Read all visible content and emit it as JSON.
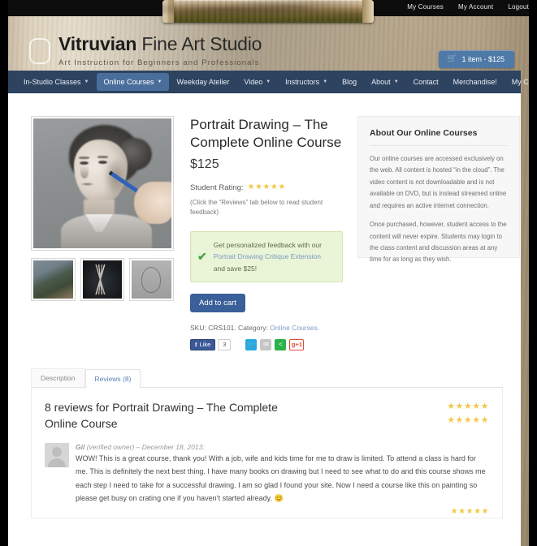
{
  "topnav": {
    "items": [
      {
        "label": "My Courses"
      },
      {
        "label": "My Account"
      },
      {
        "label": "Logout"
      }
    ]
  },
  "brand": {
    "name_bold": "Vitruvian",
    "name_light": "Fine Art Studio",
    "tagline": "Art Instruction for Beginners and Professionals",
    "logo_icon": "rounded-square-outline-icon"
  },
  "cart": {
    "icon": "shopping-cart-icon",
    "label": "1 item - $125",
    "color": "#4f7aa8"
  },
  "mainnav": {
    "items": [
      {
        "label": "In-Studio Classes",
        "has_caret": true,
        "active": false
      },
      {
        "label": "Online Courses",
        "has_caret": true,
        "active": true
      },
      {
        "label": "Weekday Atelier",
        "has_caret": false,
        "active": false
      },
      {
        "label": "Video",
        "has_caret": true,
        "active": false
      },
      {
        "label": "Instructors",
        "has_caret": true,
        "active": false
      },
      {
        "label": "Blog",
        "has_caret": false,
        "active": false
      },
      {
        "label": "About",
        "has_caret": true,
        "active": false
      },
      {
        "label": "Contact",
        "has_caret": false,
        "active": false
      },
      {
        "label": "Merchandise!",
        "has_caret": false,
        "active": false
      },
      {
        "label": "My Courses",
        "has_caret": false,
        "active": false
      }
    ],
    "bar_color": "#2d4360",
    "active_color": "#4a6e9b"
  },
  "product": {
    "title": "Portrait Drawing – The Complete Online Course",
    "price": "$125",
    "rating_label": "Student Rating:",
    "rating_stars": "★★★★★",
    "rating_note": "(Click the “Reviews” tab below to read student feedback)",
    "main_image_alt": "charcoal-portrait-drawing",
    "thumbnails": [
      {
        "alt": "instructor-at-easel-thumbnail"
      },
      {
        "alt": "drawing-pencils-thumbnail"
      },
      {
        "alt": "portrait-sketch-thumbnail"
      }
    ],
    "promo": {
      "check_icon": "check-mark-icon",
      "text_before": "Get personalized feedback with our ",
      "link": "Portrait Drawing Critique Extension",
      "text_after": " and save $25!",
      "bg_color": "#eaf4d7"
    },
    "add_to_cart_label": "Add to cart",
    "sku_prefix": "SKU: CRS101. Category: ",
    "category_link": "Online Courses.",
    "social": {
      "facebook_label": "Like",
      "facebook_count": "3",
      "twitter_icon": "twitter-icon",
      "email_icon": "email-icon",
      "share_icon": "share-icon",
      "googleplus_label": "g+1"
    }
  },
  "sidebar": {
    "title": "About Our Online Courses",
    "paragraphs": [
      "Our online courses are accessed exclusively on the web. All content is hosted “in the cloud”. The video content is not downloadable and is not available on DVD, but is instead streamed online and requires an active internet connection.",
      "Once purchased, however, student access to the content will never expire. Students may login to the class content and discussion areas at any time for as long as they wish."
    ]
  },
  "tabs": [
    {
      "label": "Description",
      "active": false
    },
    {
      "label": "Reviews (8)",
      "active": true
    }
  ],
  "reviews_section": {
    "heading": "8 reviews for Portrait Drawing – The Complete Online Course",
    "summary_stars_1": "★★★★★",
    "summary_stars_2": "★★★★★",
    "items": [
      {
        "author": "Gil",
        "meta": " (verified owner) – December 18, 2013:",
        "text": "WOW! This is a great course, thank you! With a job, wife and kids time for me to draw is limited. To attend a class is hard for me. This is definitely the next best thing. I have many books on drawing but I need to see what to do and this course shows me each step I need to take for a successful drawing. I am so glad I found your site. Now I need a course like this on painting so please get busy on crating one if you haven’t started already.",
        "emoji": "😊",
        "stars": "★★★★★",
        "avatar_icon": "user-avatar-icon"
      }
    ]
  }
}
